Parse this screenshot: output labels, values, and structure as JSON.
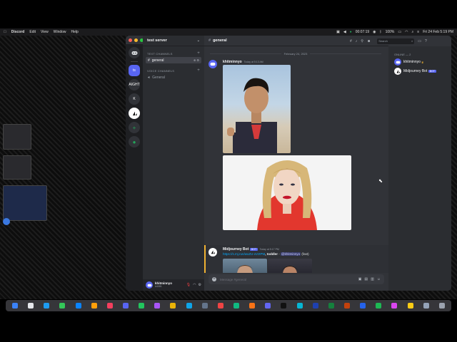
{
  "menubar": {
    "apple": "",
    "app_name": "Discord",
    "menus": [
      "Edit",
      "View",
      "Window",
      "Help"
    ],
    "timer": "00:07:19",
    "battery": "100%",
    "clock": "Fri 24 Feb  5:19 PM"
  },
  "guilds": [
    {
      "label": "ts",
      "active": true
    },
    {
      "label": "AIGHT"
    },
    {
      "label": "K"
    },
    {
      "label": "",
      "type": "midjourney"
    },
    {
      "label": "+",
      "type": "add"
    },
    {
      "label": "●",
      "type": "discover"
    }
  ],
  "sidebar": {
    "server_name": "test server",
    "text_category": "TEXT CHANNELS",
    "voice_category": "VOICE CHANNELS",
    "text_channels": [
      "general"
    ],
    "voice_channels": [
      "General"
    ]
  },
  "user": {
    "name": "khitminnyo",
    "tag": "#4081"
  },
  "channel_header": {
    "name": "general"
  },
  "search": {
    "placeholder": "Search"
  },
  "messages": {
    "date_divider": "February 24, 2023",
    "first_author": "khitminnyo",
    "first_time": "Today at 5:13 AM",
    "bot_author": "Midjourney Bot",
    "bot_badge": "BOT",
    "bot_time": "Today at 5:17 PM",
    "bot_link": "https://s.mj.run/wxZU-xVztPM",
    "bot_prompt": ", toddler",
    "bot_dash": " - ",
    "bot_mention": "@khitminnyo",
    "bot_speed": " (fast)"
  },
  "composer": {
    "placeholder": "Message #general"
  },
  "members": {
    "category": "ONLINE — 2",
    "list": [
      {
        "name": "khitminnyo",
        "crown": true
      },
      {
        "name": "Midjourney Bot",
        "badge": "BOT"
      }
    ]
  },
  "colors": {
    "blurple": "#5865f2",
    "bg_main": "#313338",
    "bg_sidebar": "#2b2d31",
    "bg_guilds": "#1e1f22",
    "link": "#00a8fc",
    "online": "#23a55a"
  },
  "icons": {
    "threads": "threads-icon",
    "bell": "bell-icon",
    "pin": "pin-icon",
    "members": "members-icon",
    "inbox": "inbox-icon",
    "help": "help-icon",
    "gift": "gift-icon",
    "gif": "gif-icon",
    "sticker": "sticker-icon",
    "emoji": "emoji-icon"
  }
}
